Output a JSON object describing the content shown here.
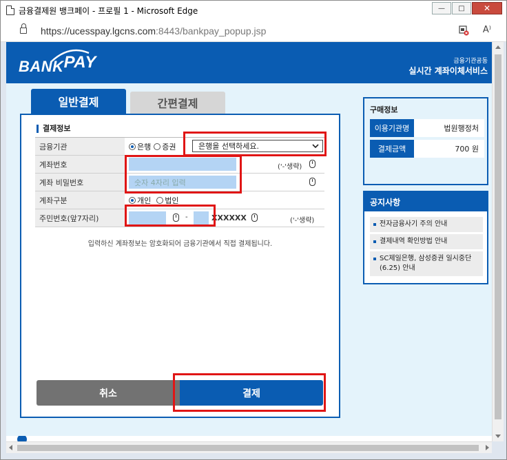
{
  "window": {
    "title": "금융결제원 뱅크페이 - 프로필 1 - Microsoft Edge",
    "minimize": "—",
    "maximize": "□",
    "close": "✕"
  },
  "address": {
    "url_host": "https://ucesspay.lgcns.com",
    "url_rest": ":8443/bankpay_popup.jsp",
    "icon_reader": "A⁾"
  },
  "header": {
    "logo_bank": "BANK",
    "logo_pay": "PAY",
    "sub": "금융기관공동",
    "main": "실시간 계좌이체서비스"
  },
  "tabs": {
    "general": "일반결제",
    "simple": "간편결제"
  },
  "form": {
    "section_title": "결제정보",
    "rows": {
      "institution": {
        "label": "금융기관",
        "radio_bank": "은행",
        "radio_securities": "증권",
        "select_value": "은행을 선택하세요."
      },
      "account": {
        "label": "계좌번호",
        "hint": "('-'생략)"
      },
      "password": {
        "label": "계좌 비밀번호",
        "placeholder": "숫자 4자리 입력"
      },
      "account_type": {
        "label": "계좌구분",
        "radio_personal": "개인",
        "radio_corporate": "법인"
      },
      "resident": {
        "label": "주민번호(앞7자리)",
        "dash": "-",
        "mask": "XXXXXX",
        "hint": "('-'생략)"
      }
    },
    "notice": "입력하신 계좌정보는 암호화되어 금융기관에서 직접 결제됩니다.",
    "cancel": "취소",
    "pay": "결제"
  },
  "purchase_info": {
    "title": "구매정보",
    "org_label": "이용기관명",
    "org_value": "법원행정처",
    "amount_label": "결제금액",
    "amount_value": "700 원"
  },
  "notices": {
    "title": "공지사항",
    "items": [
      "전자금융사기 주의 안내",
      "결제내역 확인방법 안내",
      "SC제일은행, 삼성증권 일시중단(6.25) 안내"
    ]
  },
  "colors": {
    "brand_blue": "#0a5cb2",
    "highlight_red": "#e01515",
    "input_blue": "#b4d4f4"
  }
}
